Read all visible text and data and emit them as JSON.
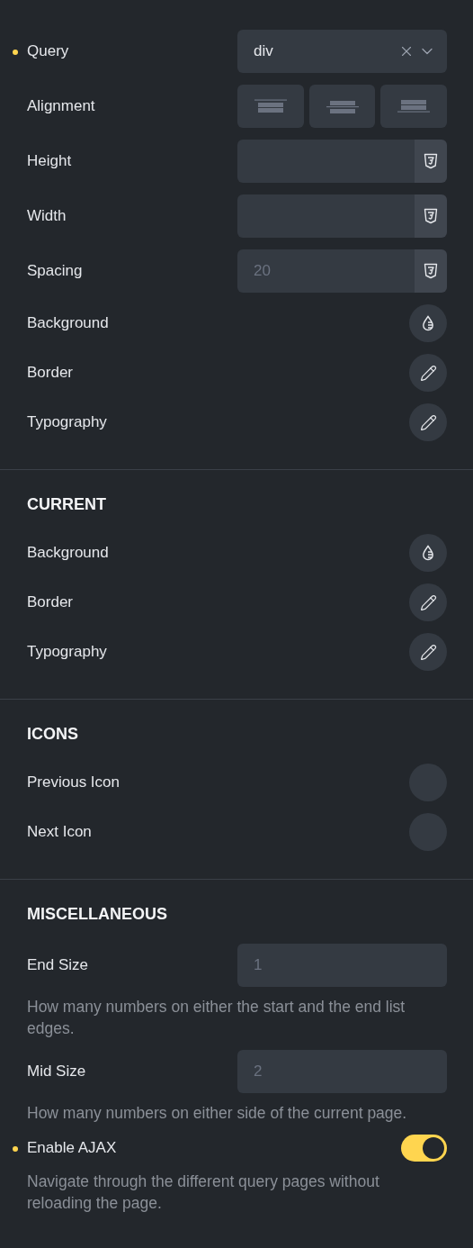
{
  "sections": [
    {
      "controls": [
        {
          "kind": "select",
          "label": "Query",
          "modified": true,
          "value": "div"
        },
        {
          "kind": "alignment",
          "label": "Alignment",
          "modified": false,
          "options": [
            {
              "selected": false
            },
            {
              "selected": false
            },
            {
              "selected": false
            }
          ]
        },
        {
          "kind": "number",
          "label": "Height",
          "modified": false
        },
        {
          "kind": "number",
          "label": "Width",
          "modified": false
        },
        {
          "kind": "number",
          "label": "Spacing",
          "modified": false,
          "placeholder": "20"
        },
        {
          "kind": "background",
          "label": "Background",
          "modified": false
        },
        {
          "kind": "edit",
          "label": "Border",
          "modified": false
        },
        {
          "kind": "edit",
          "label": "Typography",
          "modified": false
        }
      ]
    },
    {
      "title": "CURRENT",
      "controls": [
        {
          "kind": "background",
          "label": "Background",
          "modified": false
        },
        {
          "kind": "edit",
          "label": "Border",
          "modified": false
        },
        {
          "kind": "edit",
          "label": "Typography",
          "modified": false
        }
      ]
    },
    {
      "title": "ICONS",
      "controls": [
        {
          "kind": "icon",
          "label": "Previous Icon",
          "modified": false
        },
        {
          "kind": "icon",
          "label": "Next Icon",
          "modified": false
        }
      ]
    },
    {
      "title": "MISCELLANEOUS",
      "controls": [
        {
          "kind": "text",
          "label": "End Size",
          "modified": false,
          "placeholder": "1",
          "description": "How many numbers on either the start and the end list edges."
        },
        {
          "kind": "text",
          "label": "Mid Size",
          "modified": false,
          "placeholder": "2",
          "description": "How many numbers on either side of the current page."
        },
        {
          "kind": "toggle",
          "label": "Enable AJAX",
          "modified": true,
          "on": true,
          "description": "Navigate through the different query pages without reloading the page."
        }
      ]
    }
  ]
}
